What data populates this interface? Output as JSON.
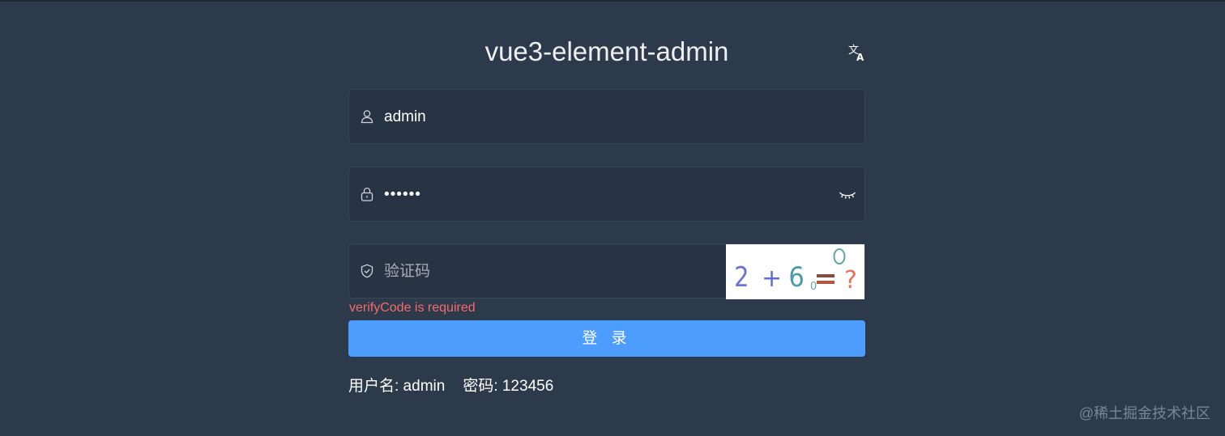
{
  "title": "vue3-element-admin",
  "language_icon": "translate-icon",
  "username": {
    "icon": "user-icon",
    "value": "admin"
  },
  "password": {
    "icon": "lock-icon",
    "value": "••••••",
    "visibility_icon": "eye-closed-icon"
  },
  "verify_code": {
    "icon": "shield-icon",
    "placeholder": "验证码",
    "captcha_text": "2 + 6 = ?",
    "error": "verifyCode is required"
  },
  "login_button": "登 录",
  "tips": {
    "username": "用户名: admin",
    "password": "密码: 123456"
  },
  "watermark": "@稀土掘金技术社区",
  "colors": {
    "background": "#2d3a4b",
    "field_bg": "#283443",
    "primary": "#4d9dff",
    "error": "#f56c6c"
  }
}
